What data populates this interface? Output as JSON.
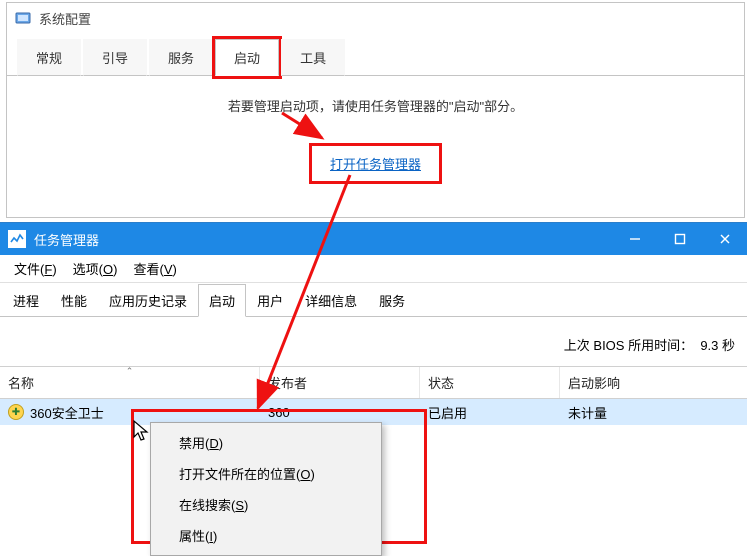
{
  "msconfig": {
    "title": "系统配置",
    "tabs": [
      {
        "label": "常规"
      },
      {
        "label": "引导"
      },
      {
        "label": "服务"
      },
      {
        "label": "启动"
      },
      {
        "label": "工具"
      }
    ],
    "instruction": "若要管理启动项，请使用任务管理器的\"启动\"部分。",
    "link": "打开任务管理器"
  },
  "taskmgr": {
    "title": "任务管理器",
    "menubar": [
      {
        "label": "文件",
        "key": "F"
      },
      {
        "label": "选项",
        "key": "O"
      },
      {
        "label": "查看",
        "key": "V"
      }
    ],
    "tabs": [
      {
        "label": "进程"
      },
      {
        "label": "性能"
      },
      {
        "label": "应用历史记录"
      },
      {
        "label": "启动"
      },
      {
        "label": "用户"
      },
      {
        "label": "详细信息"
      },
      {
        "label": "服务"
      }
    ],
    "bios_label": "上次 BIOS 所用时间：",
    "bios_value": "9.3 秒",
    "columns": {
      "name": "名称",
      "publisher": "发布者",
      "status": "状态",
      "impact": "启动影响"
    },
    "row": {
      "name": "360安全卫士",
      "publisher": "360",
      "status": "已启用",
      "impact": "未计量"
    },
    "context_menu": [
      {
        "label": "禁用",
        "key": "D"
      },
      {
        "label": "打开文件所在的位置",
        "key": "O"
      },
      {
        "label": "在线搜索",
        "key": "S"
      },
      {
        "label": "属性",
        "key": "I"
      }
    ]
  }
}
